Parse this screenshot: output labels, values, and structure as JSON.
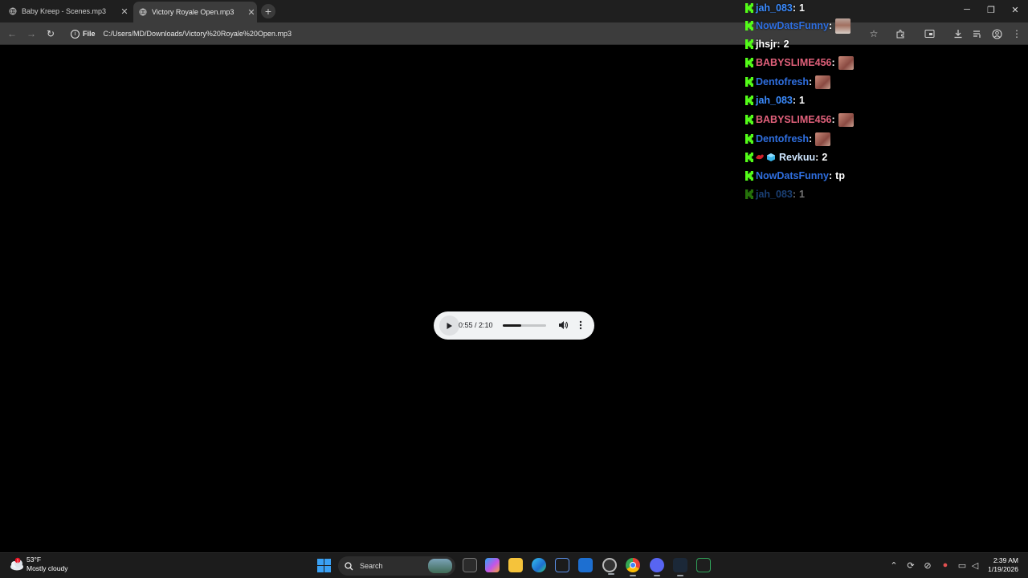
{
  "browser": {
    "tabs": [
      {
        "title": "Baby Kreep - Scenes.mp3",
        "active": false
      },
      {
        "title": "Victory Royale Open.mp3",
        "active": true
      }
    ],
    "address": {
      "chip": "File",
      "url": "C:/Users/MD/Downloads/Victory%20Royale%20Open.mp3"
    }
  },
  "player": {
    "time": "0:55 / 2:10",
    "progress_fraction": 0.42
  },
  "chat": {
    "kick_badge_color": "#53fc18",
    "messages": [
      {
        "user": "jah_083",
        "color": "#3b8cff",
        "text": "1"
      },
      {
        "user": "NowDatsFunny",
        "color": "#2f6fe0",
        "text": "",
        "emote": "face"
      },
      {
        "user": "jhsjr",
        "color": "#ffffff",
        "text": "2"
      },
      {
        "user": "BABYSLIME456",
        "color": "#e0607a",
        "text": "",
        "emote": "emote"
      },
      {
        "user": "Dentofresh",
        "color": "#2f6fe0",
        "text": "",
        "emote": "emote"
      },
      {
        "user": "jah_083",
        "color": "#3b8cff",
        "text": "1"
      },
      {
        "user": "BABYSLIME456",
        "color": "#e0607a",
        "text": "",
        "emote": "emote"
      },
      {
        "user": "Dentofresh",
        "color": "#2f6fe0",
        "text": "",
        "emote": "emote"
      },
      {
        "user": "Revkuu",
        "color": "#cfe6ff",
        "text": "2",
        "extra_badges": true
      },
      {
        "user": "NowDatsFunny",
        "color": "#2f6fe0",
        "text": "tp"
      },
      {
        "user": "jah_083",
        "color": "#3b8cff",
        "text": "1",
        "faded": true
      }
    ]
  },
  "taskbar": {
    "weather": {
      "temp": "53°F",
      "condition": "Mostly cloudy"
    },
    "search_label": "Search",
    "clock": {
      "time": "2:39 AM",
      "date": "1/19/2026"
    }
  }
}
